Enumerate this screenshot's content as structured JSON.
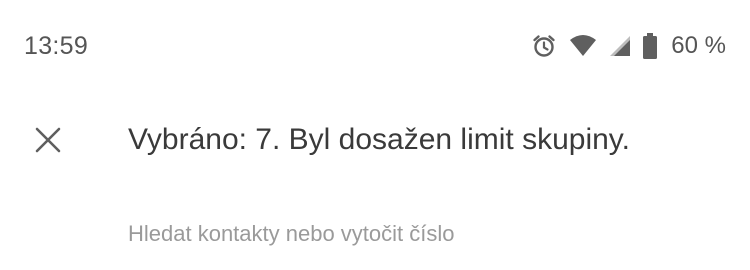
{
  "status_bar": {
    "time": "13:59",
    "battery_percent": "60 %",
    "icons": [
      "alarm-icon",
      "wifi-icon",
      "signal-icon",
      "battery-icon"
    ]
  },
  "selection_bar": {
    "title": "Vybráno: 7. Byl dosažen limit skupiny.",
    "close_icon": "close-icon"
  },
  "search": {
    "placeholder": "Hledat kontakty nebo vytočit číslo",
    "value": ""
  },
  "colors": {
    "background": "#ffffff",
    "icon_gray": "#5f5f5f",
    "title_text": "#3a3a3a",
    "placeholder_text": "#9a9a9a"
  }
}
